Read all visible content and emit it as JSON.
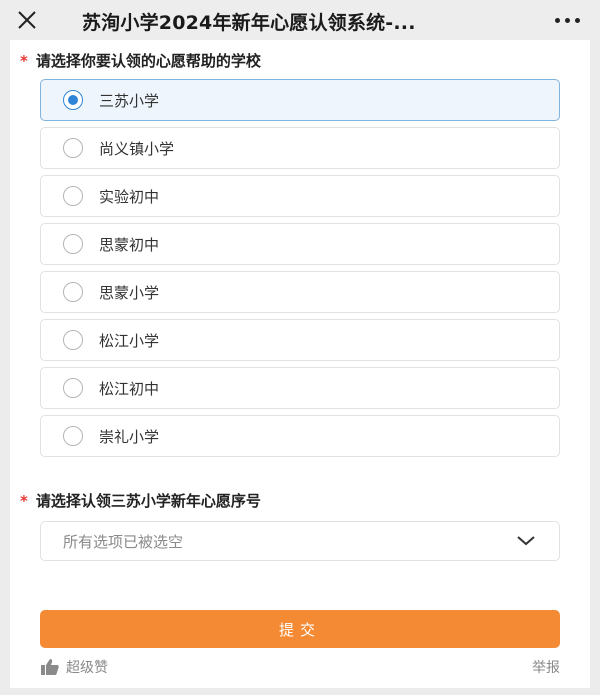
{
  "header": {
    "title": "苏洵小学2024年新年心愿认领系统-...",
    "close_icon": "close-icon",
    "more_icon": "more-icon"
  },
  "question1": {
    "required_mark": "*",
    "title": "请选择你要认领的心愿帮助的学校",
    "options": [
      {
        "label": "三苏小学",
        "selected": true
      },
      {
        "label": "尚义镇小学",
        "selected": false
      },
      {
        "label": "实验初中",
        "selected": false
      },
      {
        "label": "思蒙初中",
        "selected": false
      },
      {
        "label": "思蒙小学",
        "selected": false
      },
      {
        "label": "松江小学",
        "selected": false
      },
      {
        "label": "松江初中",
        "selected": false
      },
      {
        "label": "崇礼小学",
        "selected": false
      }
    ]
  },
  "question2": {
    "required_mark": "*",
    "title": "请选择认领三苏小学新年心愿序号",
    "select_value": "所有选项已被选空"
  },
  "submit": {
    "label": "提交"
  },
  "footer": {
    "like_label": "超级赞",
    "report_label": "举报"
  },
  "colors": {
    "accent": "#f58a34",
    "radio_selected": "#2f86d6",
    "required": "#e53935"
  }
}
